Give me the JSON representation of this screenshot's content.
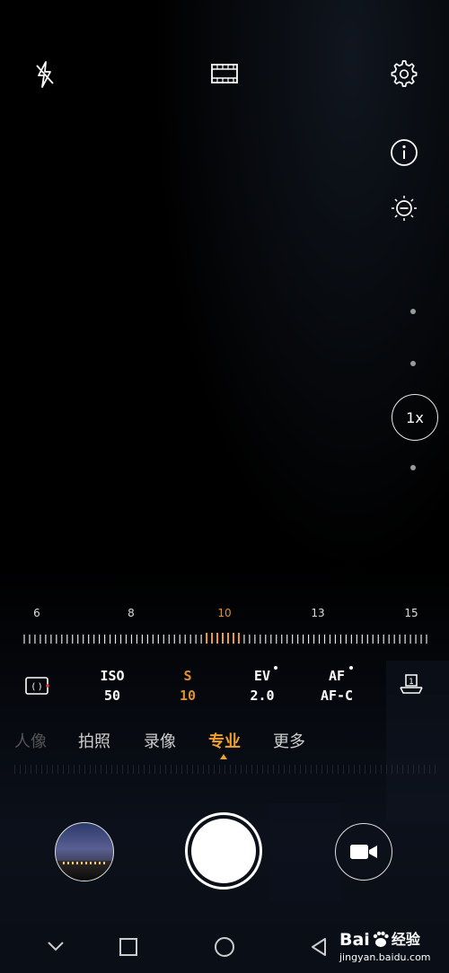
{
  "toolbar": {
    "flash_icon": "flash-off-icon",
    "mode_icon": "film-icon",
    "settings_icon": "gear-icon"
  },
  "side": {
    "info_icon": "info-icon",
    "metering_icon": "exposure-icon",
    "zoom_label": "1x"
  },
  "scale": {
    "labels": [
      "6",
      "8",
      "10",
      "13",
      "15"
    ],
    "active_index": 2
  },
  "params": [
    {
      "key": "ISO",
      "value": "50"
    },
    {
      "key": "S",
      "value": "10"
    },
    {
      "key": "EV",
      "value": "2.0"
    },
    {
      "key": "AF",
      "value": "AF-C"
    }
  ],
  "modes": [
    "人像",
    "拍照",
    "录像",
    "专业",
    "更多"
  ],
  "active_mode": "专业",
  "navbar": {
    "back_icon": "triangle-back-icon",
    "home_icon": "circle-home-icon",
    "recents_icon": "square-recents-icon",
    "down_icon": "chevron-down-icon"
  },
  "watermark": {
    "brand": "Bai",
    "brand_suffix": "经验",
    "url": "jingyan.baidu.com"
  },
  "colors": {
    "accent": "#f0a030",
    "background": "#000000"
  }
}
